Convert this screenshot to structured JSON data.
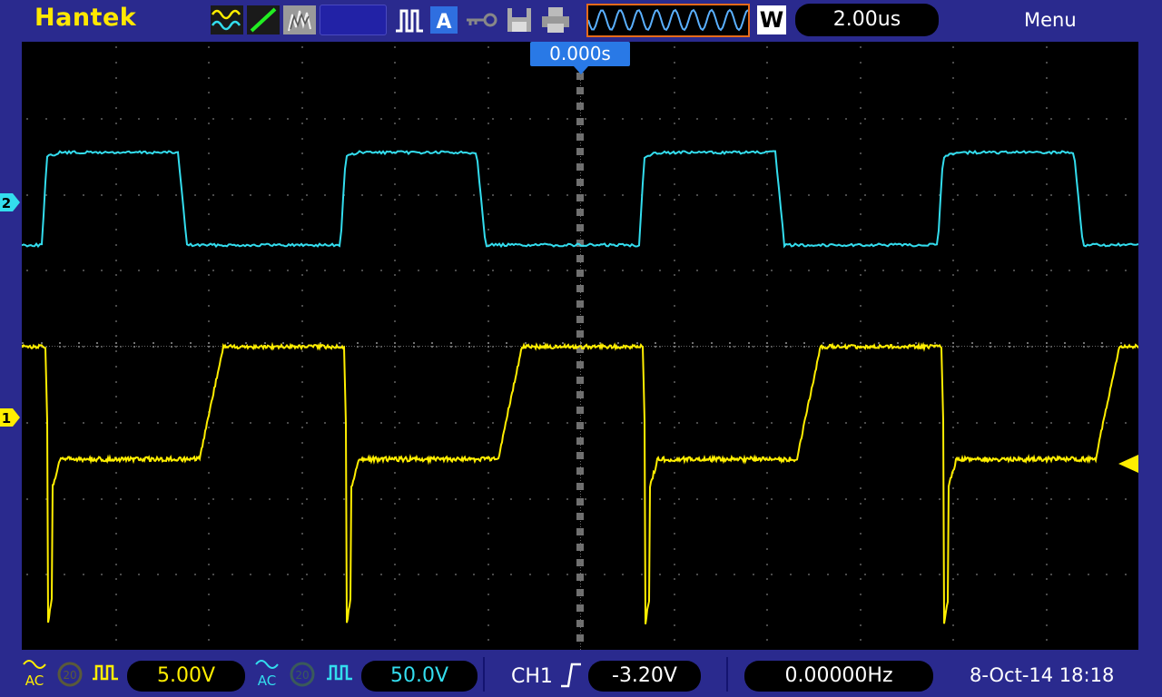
{
  "header": {
    "brand": "Hantek",
    "timebase": "2.00us",
    "acq_mode": "W",
    "menu_label": "Menu"
  },
  "trigger_position": "0.000s",
  "channels": {
    "ch1": {
      "marker": "1",
      "color": "#ffee00",
      "coupling": "AC",
      "scale": "5.00V"
    },
    "ch2": {
      "marker": "2",
      "color": "#33ddee",
      "coupling": "AC",
      "scale": "50.0V"
    }
  },
  "trigger": {
    "source": "CH1",
    "slope": "rising",
    "level": "-3.20V"
  },
  "frequency": "0.00000Hz",
  "datetime": "8-Oct-14 18:18",
  "icons": [
    "waveform-icon",
    "cursor-line-icon",
    "persist-icon",
    "run-stop-icon",
    "auto-icon",
    "key-icon",
    "save-icon",
    "print-icon",
    "memory-waveform-icon"
  ],
  "colors": {
    "background": "#2a2a8e",
    "grid": "#5a5a5a",
    "ch1": "#ffee00",
    "ch2": "#33ddee",
    "trigger_pos": "#2979e6"
  }
}
